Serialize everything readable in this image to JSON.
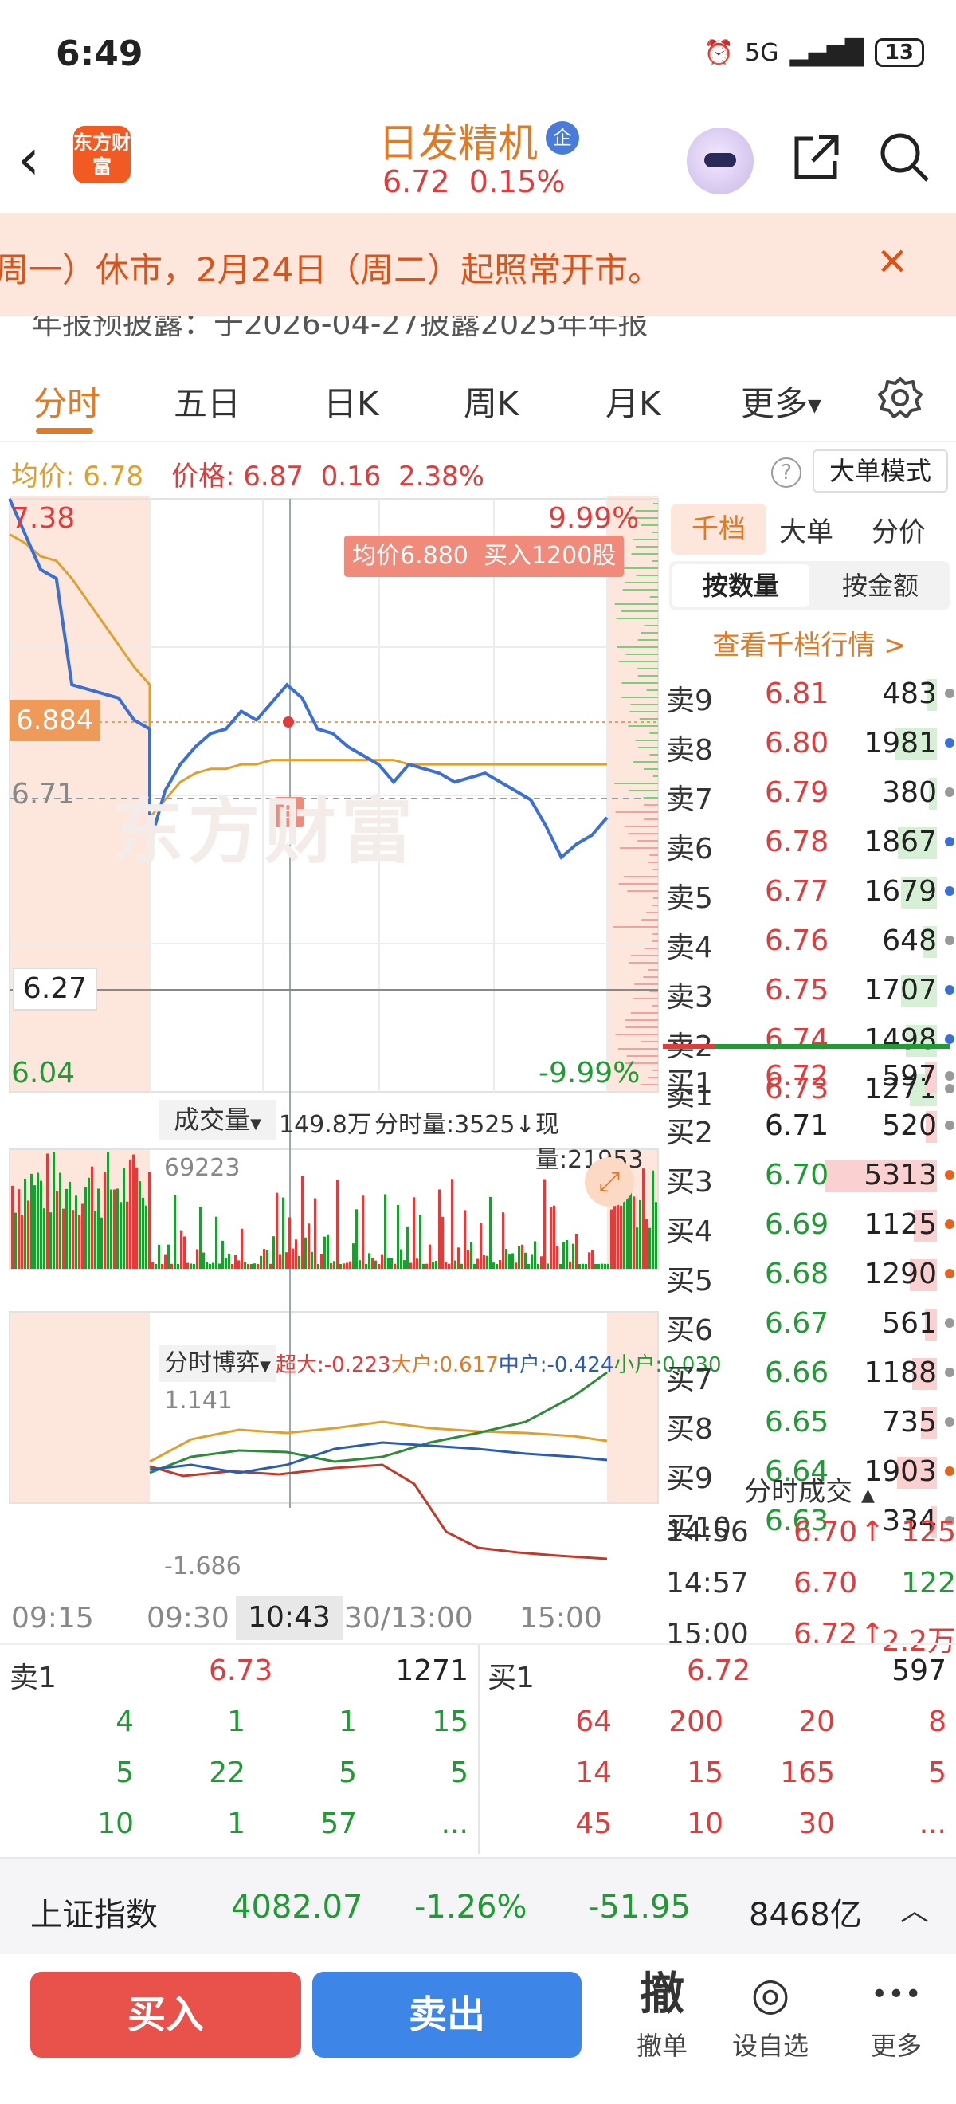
{
  "status_bar": {
    "time": "6:49",
    "network": "5G",
    "battery": "13"
  },
  "header": {
    "logo_text": "东方财富",
    "stock_name": "日发精机",
    "badge": "企",
    "price": "6.72",
    "change_pct": "0.15%"
  },
  "banner": {
    "text": "周一）休市，2月24日（周二）起照常开市。"
  },
  "notice_strip": {
    "text": "年报预披露：于2026-04-27披露2025年年报"
  },
  "tabs": [
    {
      "label": "分时",
      "active": true
    },
    {
      "label": "五日",
      "active": false
    },
    {
      "label": "日K",
      "active": false
    },
    {
      "label": "周K",
      "active": false
    },
    {
      "label": "月K",
      "active": false
    },
    {
      "label": "更多",
      "active": false
    }
  ],
  "info_row": {
    "avg_label": "均价:",
    "avg_value": "6.78",
    "price_label": "价格:",
    "price_value": "6.87",
    "price_change": "0.16",
    "price_pct": "2.38%",
    "big_order_mode": "大单模式"
  },
  "chart": {
    "high_label": "7.38",
    "low_label": "6.04",
    "prev_close_label": "6.71",
    "crosshair_price": "6.884",
    "hline_price": "6.27",
    "top_pct": "9.99%",
    "bottom_pct": "-9.99%",
    "tooltip": "均价6.880  买入1200股",
    "buy_marker": "B",
    "watermark": "东方财富",
    "volume_toolbar": {
      "selector": "成交量",
      "total": "149.8万",
      "minute_vol": "分时量:3525↓",
      "current": "现量:21953"
    },
    "volume_max": "69223",
    "game_toolbar": {
      "selector": "分时博弈",
      "super": "超大:-0.223",
      "large": "大户:0.617",
      "medium": "中户:-0.424",
      "small": "小户:0.030"
    },
    "game_max": "1.141",
    "game_min": "-1.686",
    "time_axis": [
      "09:15",
      "09:30",
      "10:43",
      "30/13:00",
      "15:00"
    ]
  },
  "chart_data": {
    "type": "line",
    "title": "",
    "xlabel": "",
    "ylabel": "",
    "ylim": [
      6.04,
      7.38
    ],
    "series": [
      {
        "name": "价格",
        "values": [
          7.38,
          7.3,
          7.22,
          7.2,
          6.96,
          6.95,
          6.94,
          6.93,
          6.88,
          6.86,
          6.6,
          6.72,
          6.78,
          6.82,
          6.85,
          6.86,
          6.9,
          6.88,
          6.92,
          6.96,
          6.93,
          6.86,
          6.85,
          6.82,
          6.8,
          6.78,
          6.74,
          6.78,
          6.77,
          6.76,
          6.74,
          6.75,
          6.76,
          6.74,
          6.72,
          6.7,
          6.64,
          6.57,
          6.6,
          6.62,
          6.66
        ]
      },
      {
        "name": "均价",
        "values": [
          7.3,
          7.28,
          7.25,
          7.24,
          7.2,
          7.15,
          7.1,
          7.05,
          7.0,
          6.96,
          6.66,
          6.7,
          6.74,
          6.76,
          6.77,
          6.77,
          6.78,
          6.78,
          6.79,
          6.79,
          6.79,
          6.79,
          6.79,
          6.79,
          6.79,
          6.79,
          6.79,
          6.78,
          6.78,
          6.78,
          6.78,
          6.78,
          6.78,
          6.78,
          6.78,
          6.78,
          6.78,
          6.78,
          6.78,
          6.78,
          6.78
        ]
      }
    ]
  },
  "right_panel": {
    "tabs": [
      "千档",
      "大单",
      "分价"
    ],
    "seg_qty": "按数量",
    "seg_amt": "按金额",
    "view_link": "查看千档行情 >",
    "asks": [
      {
        "label": "卖9",
        "price": "6.81",
        "vol": "483",
        "ratio": 0.09,
        "dot": "#999999"
      },
      {
        "label": "卖8",
        "price": "6.80",
        "vol": "1981",
        "ratio": 0.37,
        "dot": "#3b6fd1"
      },
      {
        "label": "卖7",
        "price": "6.79",
        "vol": "380",
        "ratio": 0.07,
        "dot": "#999999"
      },
      {
        "label": "卖6",
        "price": "6.78",
        "vol": "1867",
        "ratio": 0.35,
        "dot": "#3b6fd1"
      },
      {
        "label": "卖5",
        "price": "6.77",
        "vol": "1679",
        "ratio": 0.32,
        "dot": "#3b6fd1"
      },
      {
        "label": "卖4",
        "price": "6.76",
        "vol": "648",
        "ratio": 0.12,
        "dot": "#999999"
      },
      {
        "label": "卖3",
        "price": "6.75",
        "vol": "1707",
        "ratio": 0.32,
        "dot": "#3b6fd1"
      },
      {
        "label": "卖2",
        "price": "6.74",
        "vol": "1498",
        "ratio": 0.28,
        "dot": "#3b6fd1"
      },
      {
        "label": "卖1",
        "price": "6.73",
        "vol": "1271",
        "ratio": 0.24,
        "dot": "#999999"
      }
    ],
    "bids": [
      {
        "label": "买1",
        "price": "6.72",
        "vol": "597",
        "ratio": 0.11,
        "dot": "#999999",
        "price_color": "#e23b3b"
      },
      {
        "label": "买2",
        "price": "6.71",
        "vol": "520",
        "ratio": 0.1,
        "dot": "#999999",
        "price_color": "#222222"
      },
      {
        "label": "买3",
        "price": "6.70",
        "vol": "5313",
        "ratio": 1.0,
        "dot": "#e0661f",
        "price_color": "#1f9b33"
      },
      {
        "label": "买4",
        "price": "6.69",
        "vol": "1125",
        "ratio": 0.21,
        "dot": "#e0661f",
        "price_color": "#1f9b33"
      },
      {
        "label": "买5",
        "price": "6.68",
        "vol": "1290",
        "ratio": 0.24,
        "dot": "#e0661f",
        "price_color": "#1f9b33"
      },
      {
        "label": "买6",
        "price": "6.67",
        "vol": "561",
        "ratio": 0.11,
        "dot": "#999999",
        "price_color": "#1f9b33"
      },
      {
        "label": "买7",
        "price": "6.66",
        "vol": "1188",
        "ratio": 0.22,
        "dot": "#999999",
        "price_color": "#1f9b33"
      },
      {
        "label": "买8",
        "price": "6.65",
        "vol": "735",
        "ratio": 0.14,
        "dot": "#999999",
        "price_color": "#1f9b33"
      },
      {
        "label": "买9",
        "price": "6.64",
        "vol": "1903",
        "ratio": 0.36,
        "dot": "#e0661f",
        "price_color": "#1f9b33"
      },
      {
        "label": "买10",
        "price": "6.63",
        "vol": "334",
        "ratio": 0.06,
        "dot": "#999999",
        "price_color": "#1f9b33"
      }
    ],
    "trades_title": "分时成交",
    "trades": [
      {
        "time": "14:56",
        "price": "6.70",
        "arrow": "↑",
        "vol": "125",
        "vol_color": "#e23b3b"
      },
      {
        "time": "14:57",
        "price": "6.70",
        "arrow": "",
        "vol": "122",
        "vol_color": "#1f9b33"
      },
      {
        "time": "15:00",
        "price": "6.72",
        "arrow": "↑",
        "vol": "2.2万",
        "vol_color": "#e23b3b"
      }
    ]
  },
  "order_table": {
    "sell_label": "卖1",
    "sell_price": "6.73",
    "sell_vol": "1271",
    "buy_label": "买1",
    "buy_price": "6.72",
    "buy_vol": "597",
    "sell_queue": [
      [
        "4",
        "1",
        "1",
        "15"
      ],
      [
        "5",
        "22",
        "5",
        "5"
      ],
      [
        "10",
        "1",
        "57",
        "..."
      ]
    ],
    "buy_queue": [
      [
        "64",
        "200",
        "20",
        "8"
      ],
      [
        "14",
        "15",
        "165",
        "5"
      ],
      [
        "45",
        "10",
        "30",
        "..."
      ]
    ]
  },
  "index_bar": {
    "name": "上证指数",
    "value": "4082.07",
    "pct": "-1.26%",
    "change": "-51.95",
    "amount": "8468亿"
  },
  "action_bar": {
    "buy": "买入",
    "sell": "卖出",
    "items": [
      {
        "icon": "撤",
        "label": "撤单"
      },
      {
        "icon": "◎",
        "label": "设自选"
      },
      {
        "icon": "•••",
        "label": "更多"
      }
    ]
  },
  "colors": {
    "accent": "#e07a24",
    "up": "#e23b3b",
    "down": "#1f9b33",
    "buy_btn": "#e8524a",
    "sell_btn": "#3d86e8"
  }
}
